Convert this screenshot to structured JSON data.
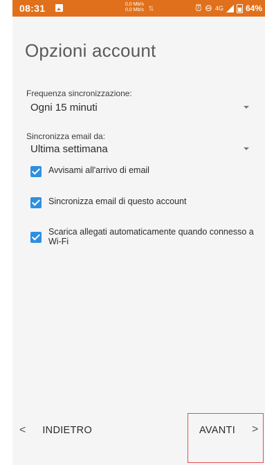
{
  "status_bar": {
    "time": "08:31",
    "speed_up": "0,0 Mb/s",
    "speed_down": "0,0 Mb/s",
    "network": "4G",
    "battery": "64%",
    "icons": [
      "image-icon",
      "transfer-arrows-icon",
      "alarm-icon",
      "dnd-icon",
      "signal-icon",
      "battery-icon"
    ]
  },
  "page": {
    "title": "Opzioni account"
  },
  "sync_frequency": {
    "label": "Frequenza sincronizzazione:",
    "value": "Ogni 15 minuti"
  },
  "sync_email_from": {
    "label": "Sincronizza email da:",
    "value": "Ultima settimana"
  },
  "checkboxes": [
    {
      "label": "Avvisami all'arrivo di email",
      "checked": true
    },
    {
      "label": "Sincronizza email di questo account",
      "checked": true
    },
    {
      "label": "Scarica allegati automaticamente quando connesso a Wi-Fi",
      "checked": true
    }
  ],
  "nav": {
    "back_label": "INDIETRO",
    "next_label": "AVANTI"
  },
  "colors": {
    "status_bar": "#e0701b",
    "checkbox": "#2f8fe0",
    "highlight_border": "#e05050",
    "background": "#f5f5f5"
  }
}
